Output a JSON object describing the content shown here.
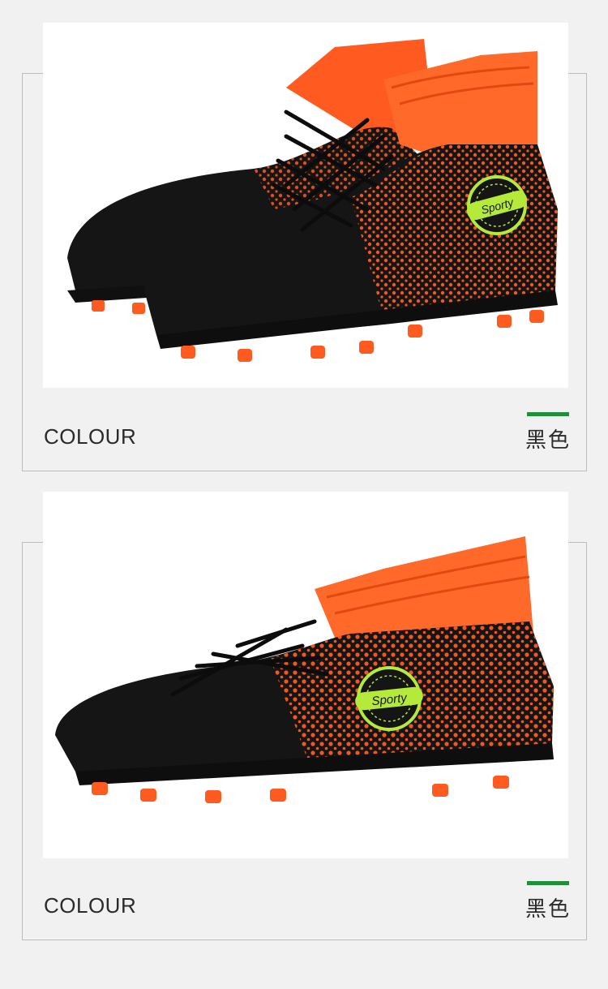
{
  "panels": [
    {
      "label": "COLOUR",
      "colour_name": "黑色",
      "logo_text": "Sporty",
      "image": "soccer-cleats-pair"
    },
    {
      "label": "COLOUR",
      "colour_name": "黑色",
      "logo_text": "Sporty",
      "image": "soccer-cleat-single"
    }
  ],
  "colors": {
    "background": "#f1f1f1",
    "frame_border": "#bdbdbd",
    "accent_bar": "#1f8f3a",
    "shoe_black": "#151515",
    "shoe_orange": "#ff5a1f",
    "logo_green": "#b5e93a"
  }
}
